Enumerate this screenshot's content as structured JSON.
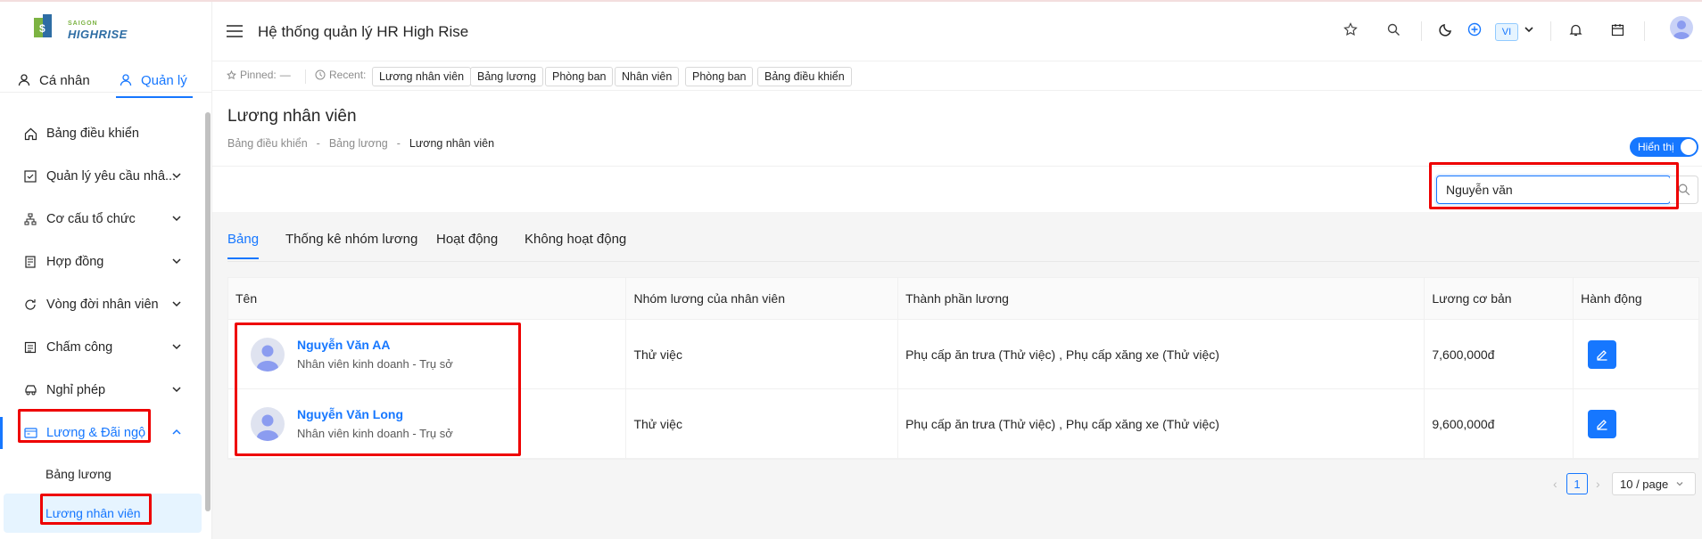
{
  "brand": {
    "small": "SAIGON",
    "big": "HIGHRISE"
  },
  "user_tabs": {
    "personal": "Cá nhân",
    "manage": "Quản lý"
  },
  "menu": [
    {
      "label": "Bảng điều khiển",
      "icon": "home-icon",
      "has_children": false
    },
    {
      "label": "Quản lý yêu cầu nhâ...",
      "icon": "checkbox-icon",
      "has_children": true
    },
    {
      "label": "Cơ cấu tổ chức",
      "icon": "org-chart-icon",
      "has_children": true
    },
    {
      "label": "Hợp đồng",
      "icon": "contract-icon",
      "has_children": true
    },
    {
      "label": "Vòng đời nhân viên",
      "icon": "cycle-icon",
      "has_children": true
    },
    {
      "label": "Chấm công",
      "icon": "timesheet-icon",
      "has_children": true
    },
    {
      "label": "Nghỉ phép",
      "icon": "car-icon",
      "has_children": true
    },
    {
      "label": "Lương & Đãi ngộ",
      "icon": "payroll-icon",
      "has_children": true,
      "expanded": true
    }
  ],
  "submenu": [
    {
      "label": "Bảng lương",
      "active": false
    },
    {
      "label": "Lương nhân viên",
      "active": true
    }
  ],
  "header": {
    "title": "Hệ thống quản lý HR High Rise",
    "lang": "VI"
  },
  "pinbar": {
    "pinned_label": "Pinned:",
    "pinned_value": "—",
    "recent_label": "Recent:",
    "recent": [
      "Lương nhân viên",
      "Bảng lương",
      "Phòng ban",
      "Nhân viên",
      "Phòng ban",
      "Bảng điều khiển"
    ]
  },
  "page": {
    "title": "Lương nhân viên",
    "breadcrumb": [
      "Bảng điều khiển",
      "Bảng lương",
      "Lương nhân viên"
    ],
    "toggle_label": "Hiển thị"
  },
  "search": {
    "value": "Nguyễn văn"
  },
  "tabs": [
    "Bảng",
    "Thống kê nhóm lương",
    "Hoạt động",
    "Không hoạt động"
  ],
  "table": {
    "headers": [
      "Tên",
      "Nhóm lương của nhân viên",
      "Thành phần lương",
      "Lương cơ bản",
      "Hành động"
    ],
    "rows": [
      {
        "name": "Nguyễn Văn AA",
        "subtitle": "Nhân viên kinh doanh - Trụ sở",
        "group": "Thử việc",
        "components": "Phụ cấp ăn trưa (Thử việc) , Phụ cấp xăng xe (Thử việc)",
        "salary": "7,600,000đ"
      },
      {
        "name": "Nguyễn Văn Long",
        "subtitle": "Nhân viên kinh doanh - Trụ sở",
        "group": "Thử việc",
        "components": "Phụ cấp ăn trưa (Thử việc) , Phụ cấp xăng xe (Thử việc)",
        "salary": "9,600,000đ"
      }
    ]
  },
  "pagination": {
    "current": "1",
    "page_size": "10 / page"
  },
  "colors": {
    "primary": "#1677ff",
    "highlight": "#e00000",
    "brand_green": "#7cb342",
    "brand_blue": "#2e6da4"
  }
}
